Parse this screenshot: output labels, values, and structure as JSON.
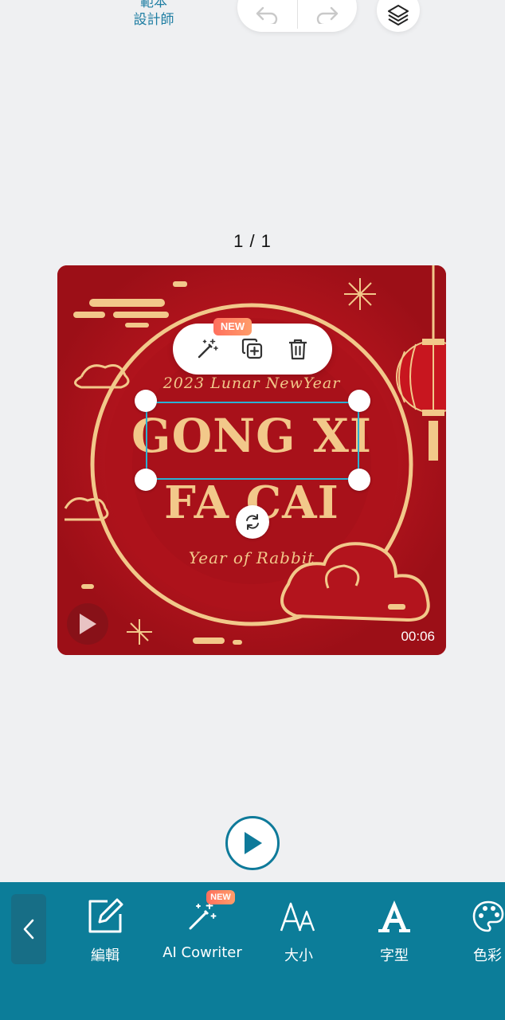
{
  "topbar": {
    "template_label_line1": "範本",
    "template_label_line2": "設計師",
    "undo_icon": "undo-icon",
    "redo_icon": "redo-icon",
    "layers_icon": "layers-icon"
  },
  "page_indicator": "1 / 1",
  "canvas": {
    "line_small": "2023 Lunar NewYear",
    "headline_line1": "GONG XI",
    "headline_line2": "FA CAI",
    "subtitle": "Year of Rabbit",
    "duration": "00:06",
    "colors": {
      "background": "#b3141d",
      "gold": "#f2c88a"
    }
  },
  "context_toolbar": {
    "new_badge": "NEW",
    "items": [
      "magic-wand-icon",
      "duplicate-icon",
      "trash-icon"
    ]
  },
  "bottom_toolbar": {
    "back_icon": "chevron-left-icon",
    "tools": [
      {
        "label": "編輯",
        "icon": "edit-icon"
      },
      {
        "label": "AI Cowriter",
        "icon": "magic-wand-icon",
        "badge": "NEW"
      },
      {
        "label": "大小",
        "icon": "font-size-icon"
      },
      {
        "label": "字型",
        "icon": "font-icon"
      },
      {
        "label": "色彩",
        "icon": "palette-icon"
      }
    ],
    "colors": {
      "bar": "#0c7d99"
    }
  }
}
